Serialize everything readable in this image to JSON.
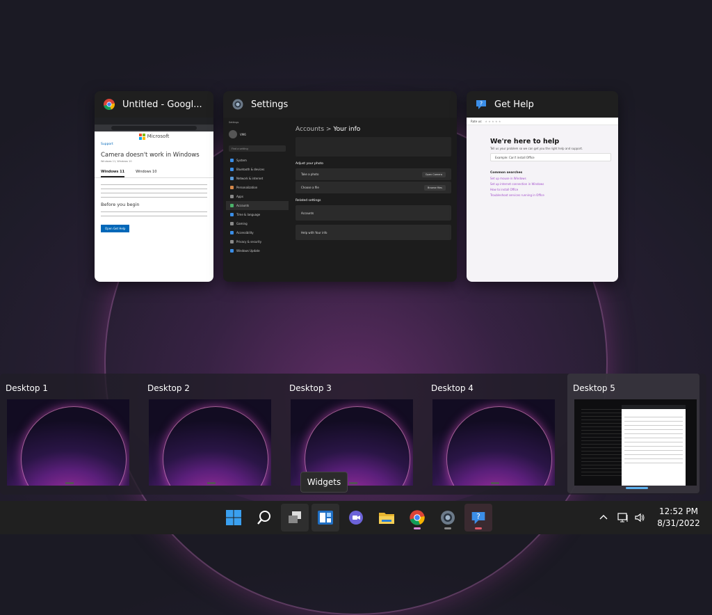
{
  "windows": [
    {
      "title": "Untitled - Googl...",
      "icon": "chrome-icon"
    },
    {
      "title": "Settings",
      "icon": "settings-gear-icon"
    },
    {
      "title": "Get Help",
      "icon": "get-help-icon"
    }
  ],
  "chrome_preview": {
    "brand": "Microsoft",
    "support": "Support",
    "heading": "Camera doesn't work in Windows",
    "applies": "Windows 11, Windows 10",
    "tab1": "Windows 11",
    "tab2": "Windows 10",
    "section": "Before you begin",
    "button": "Open Get Help"
  },
  "settings_preview": {
    "app": "Settings",
    "user": "VM6",
    "search": "Find a setting",
    "nav": [
      "System",
      "Bluetooth & devices",
      "Network & internet",
      "Personalization",
      "Apps",
      "Accounts",
      "Time & language",
      "Gaming",
      "Accessibility",
      "Privacy & security",
      "Windows Update"
    ],
    "crumb_parent": "Accounts",
    "crumb_sep": ">",
    "crumb_current": "Your info",
    "adjust": "Adjust your photo",
    "take_photo": "Take a photo",
    "open_camera": "Open Camera",
    "choose_file": "Choose a file",
    "browse": "Browse files",
    "related": "Related settings",
    "accounts": "Accounts",
    "help": "Help with Your info"
  },
  "gethelp_preview": {
    "rate": "Rate us:",
    "heading": "We're here to help",
    "sub": "Tell us your problem so we can get you the right help and support.",
    "search": "Example: Can't install Office",
    "common": "Common searches",
    "links": [
      "Set up mouse in Windows",
      "Set up internet connection in Windows",
      "How to install Office",
      "Troubleshoot services running in Office"
    ]
  },
  "desktops": [
    {
      "label": "Desktop 1"
    },
    {
      "label": "Desktop 2"
    },
    {
      "label": "Desktop 3"
    },
    {
      "label": "Desktop 4"
    },
    {
      "label": "Desktop 5"
    }
  ],
  "tooltip": "Widgets",
  "taskbar": {
    "apps": [
      "start-icon",
      "search-icon",
      "task-view-icon",
      "widgets-icon",
      "chat-icon",
      "file-explorer-icon",
      "chrome-icon",
      "settings-gear-icon",
      "get-help-icon"
    ],
    "time": "12:52 PM",
    "date": "8/31/2022"
  },
  "colors": {
    "accent": "#0067b8",
    "indicator": "#d68ad8",
    "desktop_indicator": "#5fb3f0"
  }
}
